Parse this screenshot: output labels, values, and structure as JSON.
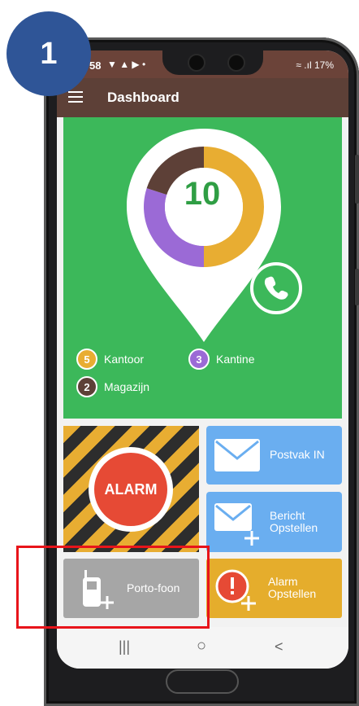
{
  "statusbar": {
    "time": "58",
    "battery": "17%",
    "left_icons": "▼ ▲ ▶ •",
    "signal": "≈ .ıl"
  },
  "toolbar": {
    "title": "Dashboard"
  },
  "summary": {
    "total": "10",
    "donut_segments": [
      {
        "label": "Kantoor",
        "count": 5,
        "color": "#e8ad32"
      },
      {
        "label": "Kantine",
        "count": 3,
        "color": "#9b6ad6"
      },
      {
        "label": "Magazijn",
        "count": 2,
        "color": "#5d4037"
      }
    ]
  },
  "legend": [
    {
      "count": "5",
      "label": "Kantoor",
      "color": "#e8ad32"
    },
    {
      "count": "3",
      "label": "Kantine",
      "color": "#9b6ad6"
    },
    {
      "count": "2",
      "label": "Magazijn",
      "color": "#5d4037"
    }
  ],
  "tiles": {
    "alarm": "ALARM",
    "postvak": "Postvak IN",
    "bericht_line1": "Bericht",
    "bericht_line2": "Opstellen",
    "porto": "Porto-foon",
    "alarm_opstellen_line1": "Alarm",
    "alarm_opstellen_line2": "Opstellen"
  },
  "navbar": {
    "recents": "|||",
    "home": "○",
    "back": "<"
  },
  "annotation": {
    "step": "1"
  },
  "icons": [
    "menu-icon",
    "phone-icon",
    "mail-icon",
    "mail-plus-icon",
    "walkie-talkie-icon",
    "alert-plus-icon"
  ],
  "colors": {
    "primary": "#5d4037",
    "green": "#3cb85a",
    "orange": "#e8ad32",
    "purple": "#9b6ad6",
    "blue": "#6aaef0",
    "red": "#e64a35",
    "annotation_blue": "#2f5597",
    "highlight_red": "#e8141a"
  }
}
